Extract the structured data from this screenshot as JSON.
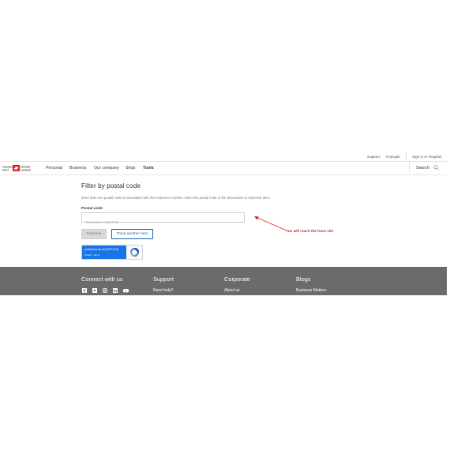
{
  "topbar": {
    "support": "Support",
    "francais": "Français",
    "sign_in": "Sign in or Register"
  },
  "nav": {
    "items": [
      {
        "label": "Personal"
      },
      {
        "label": "Business"
      },
      {
        "label": "Our company"
      },
      {
        "label": "Shop"
      },
      {
        "label": "Tools"
      }
    ],
    "search_label": "Search"
  },
  "main": {
    "title": "Filter by postal code",
    "description": "More than one postal code is associated with this reference number. Enter the postal code of the destination to track this item.",
    "postal_label": "Postal code",
    "postal_placeholder": "Example: A1B 2C3",
    "postal_value": "",
    "continue_label": "Continue",
    "track_another_label": "Track another item"
  },
  "recaptcha": {
    "text": "protected by reCAPTCHA",
    "links": "Privacy - Terms"
  },
  "annotation": {
    "text": "You will reach the trace site",
    "color": "#d9262c"
  },
  "footer": {
    "columns": [
      {
        "heading": "Connect with us",
        "first_link": ""
      },
      {
        "heading": "Support",
        "first_link": "Need help?"
      },
      {
        "heading": "Corporate",
        "first_link": "About us"
      },
      {
        "heading": "Blogs",
        "first_link": "Business Matters"
      }
    ],
    "social_icons": [
      "facebook-icon",
      "twitter-icon",
      "instagram-icon",
      "linkedin-icon",
      "youtube-icon"
    ]
  },
  "colors": {
    "brand_red": "#d9262c",
    "link_blue": "#1a5fb4",
    "footer_bg": "#6b6b6b"
  }
}
